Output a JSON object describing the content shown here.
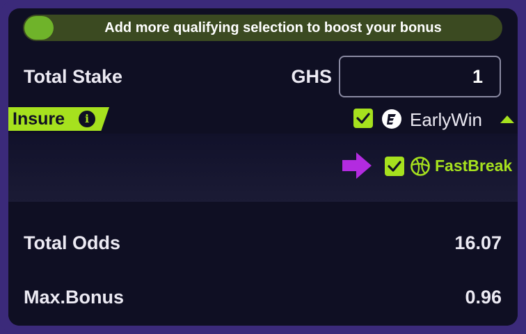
{
  "banner": {
    "text": "Add more qualifying selection to boost your bonus"
  },
  "stake": {
    "label": "Total Stake",
    "currency": "GHS",
    "value": "1"
  },
  "insure": {
    "label": "Insure",
    "options": [
      {
        "name": "EarlyWin",
        "checked": true,
        "icon": "earlywin-icon"
      },
      {
        "name": "FastBreak",
        "checked": true,
        "icon": "basketball-icon"
      }
    ]
  },
  "summary": {
    "odds_label": "Total Odds",
    "odds_value": "16.07",
    "bonus_label": "Max.Bonus",
    "bonus_value": "0.96"
  },
  "colors": {
    "accent": "#a6e11e",
    "frame": "#3b2a7a",
    "panel": "#0f0f23",
    "arrow": "#b32be0"
  }
}
